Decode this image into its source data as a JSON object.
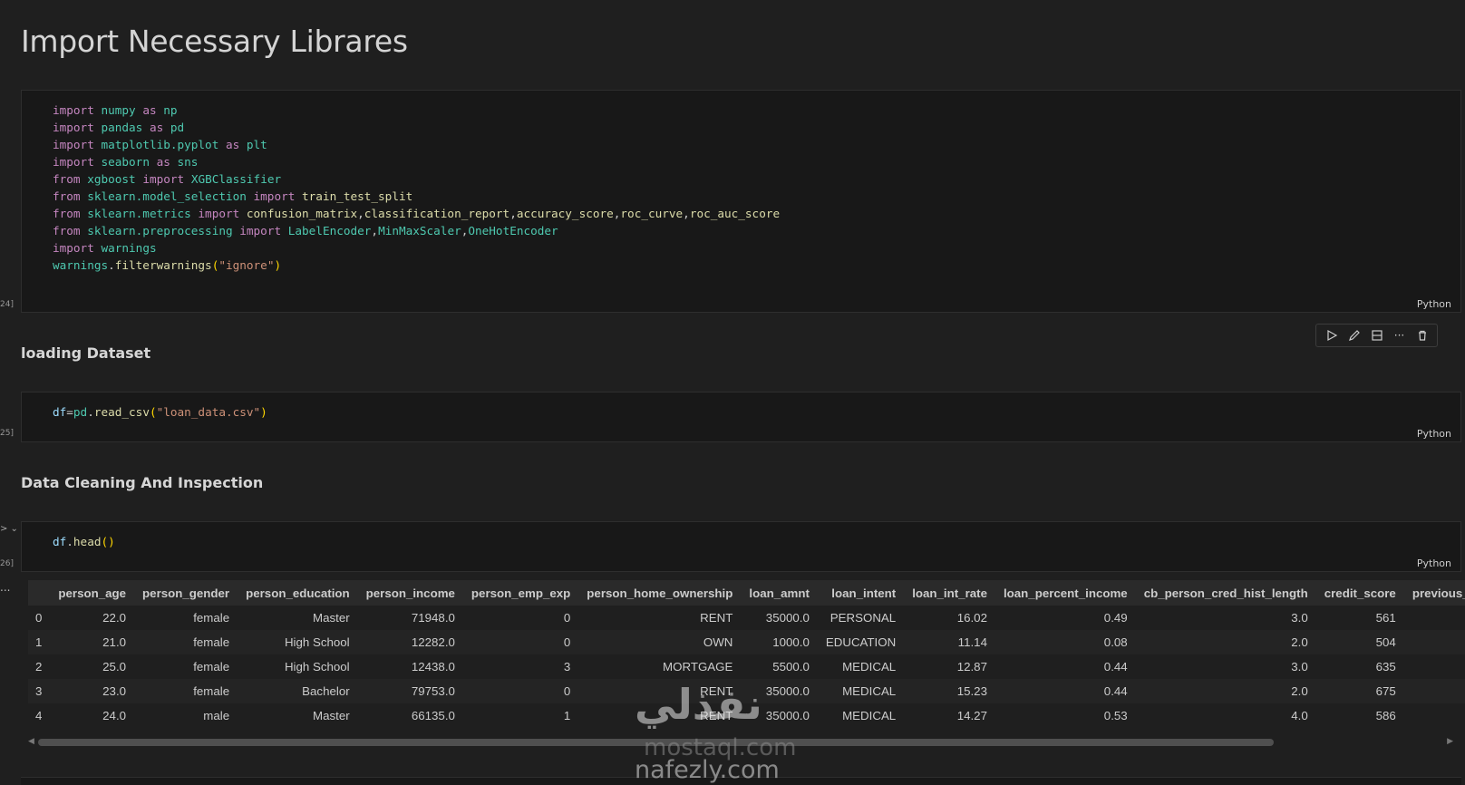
{
  "headings": {
    "import": "Import Necessary Librares",
    "loading": "loading Dataset",
    "cleaning": "Data Cleaning And Inspection"
  },
  "cells": {
    "imports": {
      "exec": "24]",
      "lang": "Python"
    },
    "load": {
      "exec": "25]",
      "lang": "Python"
    },
    "head": {
      "exec": "26]",
      "lang": "Python"
    }
  },
  "toolbar": {
    "icons": [
      "run-cell-icon",
      "edit-icon",
      "split-cell-icon",
      "more-icon",
      "delete-icon"
    ],
    "more_glyph": "···"
  },
  "output_menu_glyph": "...",
  "collapse_glyph": "> ⌄",
  "table": {
    "columns": [
      "",
      "person_age",
      "person_gender",
      "person_education",
      "person_income",
      "person_emp_exp",
      "person_home_ownership",
      "loan_amnt",
      "loan_intent",
      "loan_int_rate",
      "loan_percent_income",
      "cb_person_cred_hist_length",
      "credit_score",
      "previous_lo"
    ],
    "rows": [
      [
        "0",
        "22.0",
        "female",
        "Master",
        "71948.0",
        "0",
        "RENT",
        "35000.0",
        "PERSONAL",
        "16.02",
        "0.49",
        "3.0",
        "561",
        ""
      ],
      [
        "1",
        "21.0",
        "female",
        "High School",
        "12282.0",
        "0",
        "OWN",
        "1000.0",
        "EDUCATION",
        "11.14",
        "0.08",
        "2.0",
        "504",
        ""
      ],
      [
        "2",
        "25.0",
        "female",
        "High School",
        "12438.0",
        "3",
        "MORTGAGE",
        "5500.0",
        "MEDICAL",
        "12.87",
        "0.44",
        "3.0",
        "635",
        ""
      ],
      [
        "3",
        "23.0",
        "female",
        "Bachelor",
        "79753.0",
        "0",
        "RENT",
        "35000.0",
        "MEDICAL",
        "15.23",
        "0.44",
        "2.0",
        "675",
        ""
      ],
      [
        "4",
        "24.0",
        "male",
        "Master",
        "66135.0",
        "1",
        "RENT",
        "35000.0",
        "MEDICAL",
        "14.27",
        "0.53",
        "4.0",
        "586",
        ""
      ]
    ]
  },
  "watermark": {
    "big": "نفذلي",
    "line1": "mostaql.com",
    "line2": "nafezly.com"
  }
}
